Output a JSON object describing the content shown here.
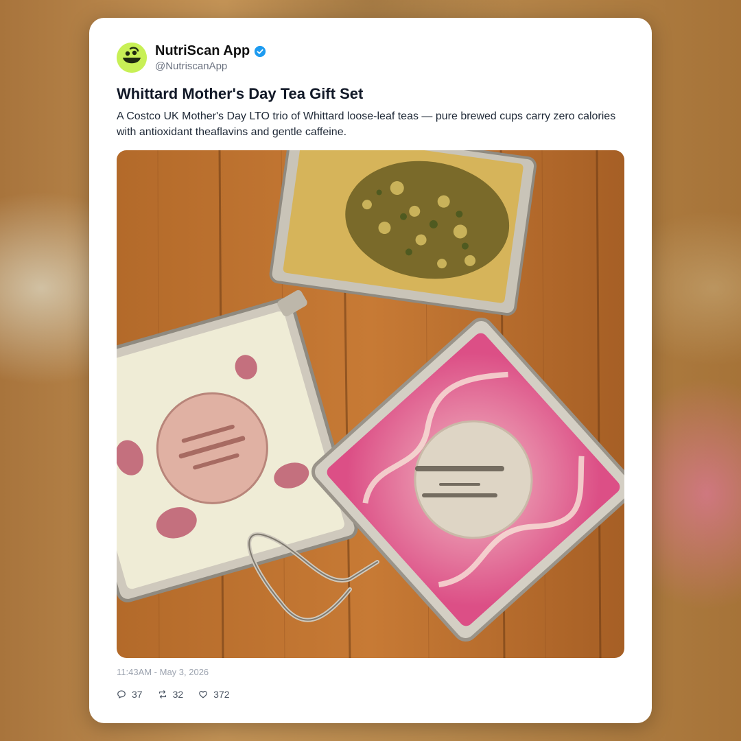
{
  "post": {
    "author_name": "NutriScan App",
    "author_handle": "@NutriscanApp",
    "verified_icon": "verified-badge-icon",
    "avatar_icon": "nutriscan-logo-icon",
    "title": "Whittard Mother's Day Tea Gift Set",
    "description": "A Costco UK Mother's Day LTO trio of Whittard loose-leaf teas — pure brewed cups carry zero calories with antioxidant theaflavins and gentle caffeine.",
    "timestamp": "11:43AM - May 3, 2026",
    "stats": {
      "replies": "37",
      "reposts": "32",
      "likes": "372"
    },
    "stat_icons": [
      "reply-icon",
      "repost-icon",
      "like-icon"
    ]
  },
  "colors": {
    "avatar_bg": "#c8f056",
    "verified_blue": "#1d9bf0",
    "text_primary": "#111827",
    "text_secondary": "#6b7280"
  }
}
